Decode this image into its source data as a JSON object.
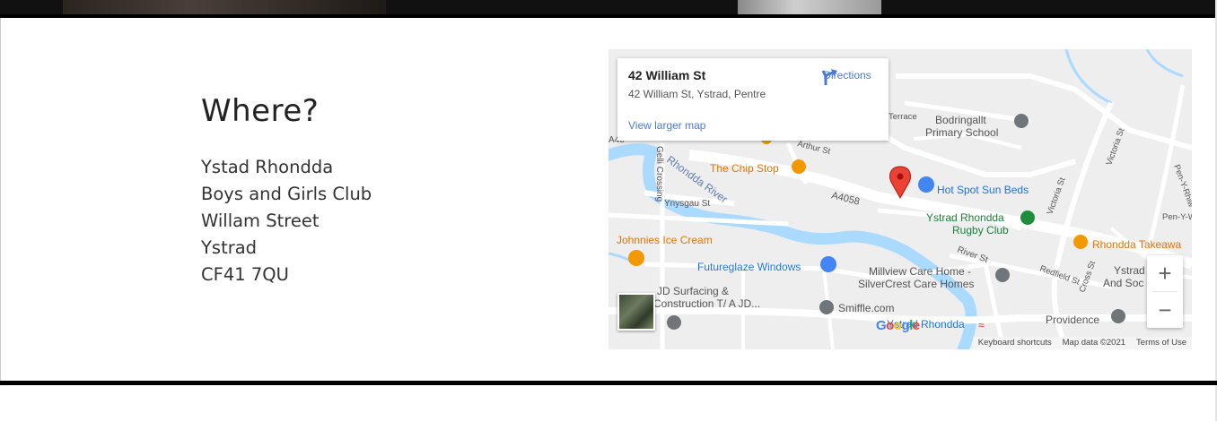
{
  "section": {
    "heading": "Where?",
    "address": [
      "Ystad Rhondda",
      "Boys and Girls Club",
      "Willam Street",
      "Ystrad",
      "CF41 7QU"
    ]
  },
  "map": {
    "place_title": "42 William St",
    "place_address": "42 William St, Ystrad, Pentre",
    "directions_label": "Directions",
    "view_larger_label": "View larger map",
    "zoom_in": "+",
    "zoom_out": "−",
    "google_logo": [
      "G",
      "o",
      "o",
      "g",
      "l",
      "e"
    ],
    "attribution": {
      "shortcuts": "Keyboard shortcuts",
      "map_data": "Map data ©2021",
      "terms": "Terms of Use"
    },
    "labels": {
      "chip_stop": "The Chip Stop",
      "hot_spot": "Hot Spot Sun Beds",
      "rugby_1": "Ystrad Rhondda",
      "rugby_2": "Rugby Club",
      "johnnies": "Johnnies Ice Cream",
      "futureglaze": "Futureglaze Windows",
      "millview_1": "Millview Care Home -",
      "millview_2": "SilverCrest Care Homes",
      "jd_1": "JD Surfacing &",
      "jd_2": "Construction T/ A JD...",
      "smiffle": "Smiffle.com",
      "station": "Ystrad Rhondda",
      "providence": "Providence",
      "takeaway": "Rhondda Takeawa",
      "ystrad_and": "Ystrad",
      "and_soc": "And Soc",
      "bodringallt_1": "Bodringallt",
      "bodringallt_2": "Primary School",
      "rhondda_river": "Rhondda River",
      "a4058": "A4058",
      "ynysgau": "Ynysgau St",
      "gelli": "Gelli Crossing",
      "river_st": "River St",
      "redfield": "Redfield St",
      "cross_st": "Cross St",
      "victoria_1": "Victoria St",
      "victoria_2": "Victoria St",
      "pen_y_rhiw": "Pen-Y-Rhiw",
      "pen_y_w": "Pen-Y-W",
      "terrace": "Terrace",
      "arthur": "Arthur St",
      "a4058_left": "A40"
    },
    "colors": {
      "water": "#aadaff",
      "road": "#ffffff",
      "land": "#eeeeee",
      "pin": "#ea4335",
      "poi_orange": "#e37400",
      "poi_blue": "#1a73e8",
      "poi_green": "#188038",
      "poi_gray": "#70757a"
    }
  }
}
